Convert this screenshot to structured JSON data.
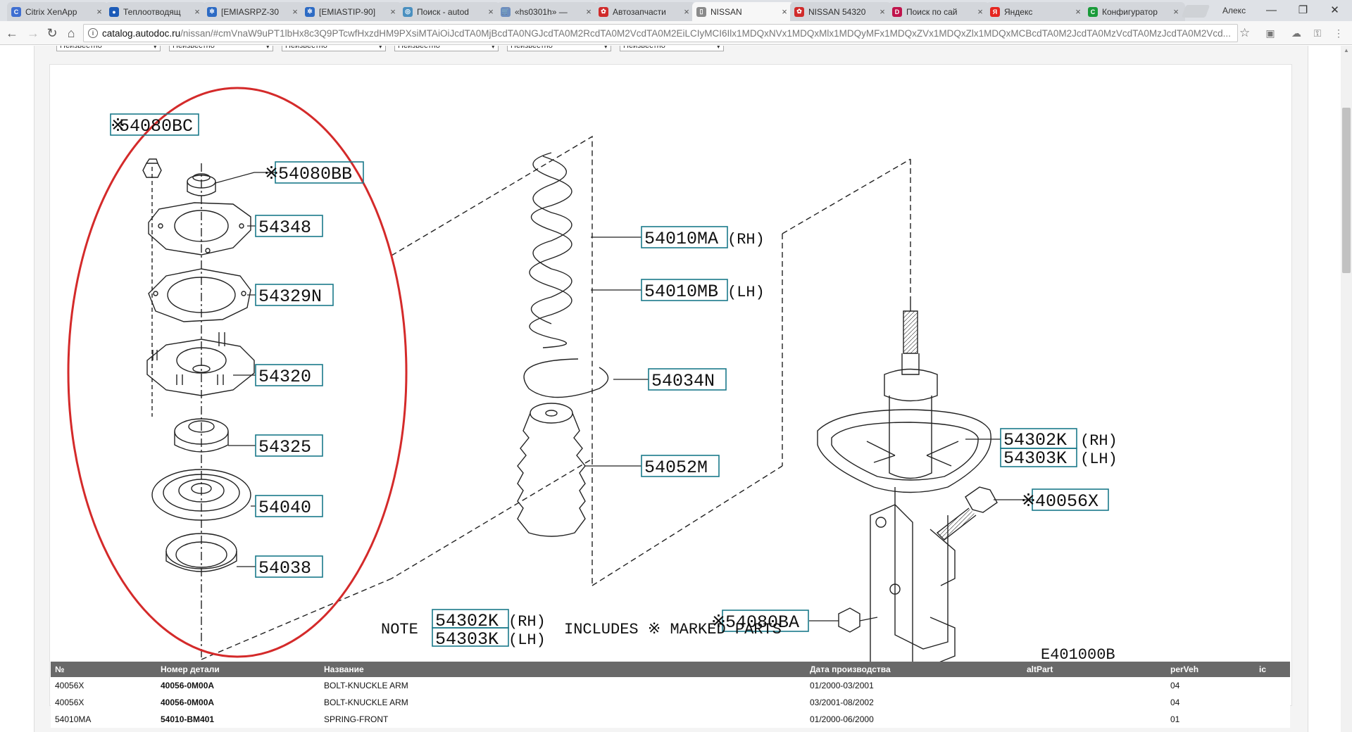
{
  "browser": {
    "tabs": [
      {
        "label": "Citrix XenApp",
        "icon_color": "#3f6fd1",
        "icon_glyph": "C",
        "active": false
      },
      {
        "label": "Теплоотводящ",
        "icon_color": "#1c5bb8",
        "icon_glyph": "●",
        "active": false
      },
      {
        "label": "[EMIASRPZ-30",
        "icon_color": "#2d6bc4",
        "icon_glyph": "✲",
        "active": false
      },
      {
        "label": "[EMIASTIP-90]",
        "icon_color": "#2d6bc4",
        "icon_glyph": "✲",
        "active": false
      },
      {
        "label": "Поиск - autod",
        "icon_color": "#4a90c0",
        "icon_glyph": "◎",
        "active": false
      },
      {
        "label": "«hs0301h» —",
        "icon_color": "#6c8ebf",
        "icon_glyph": "🛒",
        "active": false
      },
      {
        "label": "Автозапчасти",
        "icon_color": "#d02b2b",
        "icon_glyph": "✿",
        "active": false
      },
      {
        "label": "NISSAN",
        "icon_color": "#8a8a8a",
        "icon_glyph": "▯",
        "active": true
      },
      {
        "label": "NISSAN 54320",
        "icon_color": "#d02b2b",
        "icon_glyph": "✿",
        "active": false
      },
      {
        "label": "Поиск по сай",
        "icon_color": "#c0144c",
        "icon_glyph": "D",
        "active": false
      },
      {
        "label": "Яндекс",
        "icon_color": "#e52620",
        "icon_glyph": "Я",
        "active": false
      },
      {
        "label": "Конфигуратор",
        "icon_color": "#1a9b3a",
        "icon_glyph": "C",
        "active": false
      }
    ],
    "tab_close_glyph": "×",
    "profile_name": "Алекс",
    "window_buttons": {
      "minimize": "—",
      "restore": "❐",
      "close": "✕"
    },
    "nav": {
      "back": "←",
      "forward": "→",
      "reload": "↻",
      "home": "⌂"
    },
    "url_host": "catalog.autodoc.ru",
    "url_rest": "/nissan/#cmVnaW9uPT1lbHx8c3Q9PTcwfHxzdHM9PXsiMTAiOiJcdTA0MjBcdTA0NGJcdTA0M2RcdTA0M2VcdTA0M2EiLCIyMCI6Ilx1MDQxNVx1MDQxMlx1MDQyMFx1MDQxZVx1MDQxZlx1MDQxMCBcdTA0M2JcdTA0MzVcdTA0MzJcdTA0M2Vcd...",
    "info_glyph": "i",
    "star_glyph": "☆",
    "extensions": [
      "▣",
      "☁",
      "⚿",
      "⋮"
    ]
  },
  "filters": [
    {
      "value": "Неизвестно"
    },
    {
      "value": "Неизвестно"
    },
    {
      "value": "Неизвестно"
    },
    {
      "value": "Неизвестно"
    },
    {
      "value": "Неизвестно"
    },
    {
      "value": "Неизвестно"
    }
  ],
  "filter_arrow": "▾",
  "diagram": {
    "labels": {
      "l54080bc": "54080BC",
      "l54080bb": "54080BB",
      "l54348": "54348",
      "l54329n": "54329N",
      "l54320": "54320",
      "l54325": "54325",
      "l54040": "54040",
      "l54038": "54038",
      "l54010ma": "54010MA",
      "l54010mb": "54010MB",
      "l54034n": "54034N",
      "l54052m": "54052M",
      "l54302k": "54302K",
      "l54303k": "54303K",
      "l40056x": "40056X",
      "l54080ba": "54080BA",
      "note_54302k": "54302K",
      "note_54303k": "54303K"
    },
    "suffix_rh": "(RH)",
    "suffix_lh": "(LH)",
    "mark": "※",
    "note_prefix": "NOTE",
    "note_suffix": "INCLUDES ※ MARKED PARTS",
    "figure_code": "E401000B",
    "highlight_color": "#d42a2a",
    "callout_color": "#1a7a8a"
  },
  "table": {
    "headers": [
      "№",
      "Номер детали",
      "Название",
      "Дата производства",
      "altPart",
      "perVeh",
      "ic"
    ],
    "rows": [
      {
        "no": "40056X",
        "part": "40056-0M00A",
        "name": "BOLT-KNUCKLE ARM",
        "date": "01/2000-03/2001",
        "alt": "",
        "perveh": "04",
        "ic": ""
      },
      {
        "no": "40056X",
        "part": "40056-0M00A",
        "name": "BOLT-KNUCKLE ARM",
        "date": "03/2001-08/2002",
        "alt": "",
        "perveh": "04",
        "ic": ""
      },
      {
        "no": "54010MA",
        "part": "54010-BM401",
        "name": "SPRING-FRONT",
        "date": "01/2000-06/2000",
        "alt": "",
        "perveh": "01",
        "ic": ""
      }
    ]
  }
}
